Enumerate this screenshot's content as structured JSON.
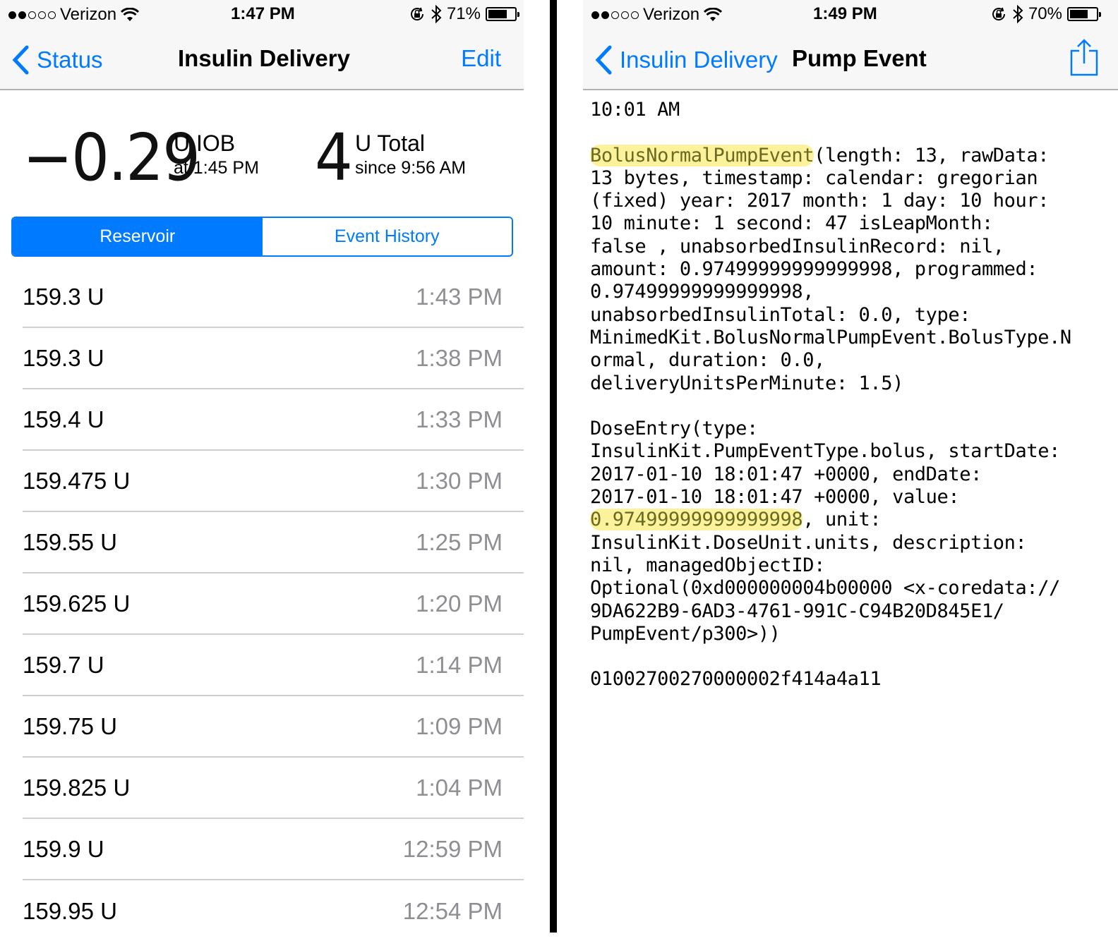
{
  "left": {
    "status_bar": {
      "carrier": "Verizon",
      "signal_bars_filled": 2,
      "signal_bars_total": 5,
      "time": "1:47 PM",
      "battery": "71%",
      "battery_fraction": 0.71
    },
    "nav": {
      "back_label": "Status",
      "title": "Insulin Delivery",
      "edit_label": "Edit"
    },
    "summary": {
      "iob_value": "−0.29",
      "iob_unit": "U IOB",
      "iob_time": "at 1:45 PM",
      "total_value": "4",
      "total_unit": "U Total",
      "total_since": "since 9:56 AM"
    },
    "segments": {
      "items": [
        "Reservoir",
        "Event History"
      ],
      "selected": "Reservoir"
    },
    "reservoir_rows": [
      {
        "value": "159.3 U",
        "time": "1:43 PM"
      },
      {
        "value": "159.3 U",
        "time": "1:38 PM"
      },
      {
        "value": "159.4 U",
        "time": "1:33 PM"
      },
      {
        "value": "159.475 U",
        "time": "1:30 PM"
      },
      {
        "value": "159.55 U",
        "time": "1:25 PM"
      },
      {
        "value": "159.625 U",
        "time": "1:20 PM"
      },
      {
        "value": "159.7 U",
        "time": "1:14 PM"
      },
      {
        "value": "159.75 U",
        "time": "1:09 PM"
      },
      {
        "value": "159.825 U",
        "time": "1:04 PM"
      },
      {
        "value": "159.9 U",
        "time": "12:59 PM"
      },
      {
        "value": "159.95 U",
        "time": "12:54 PM"
      }
    ]
  },
  "right": {
    "status_bar": {
      "carrier": "Verizon",
      "signal_bars_filled": 2,
      "signal_bars_total": 5,
      "time": "1:49 PM",
      "battery": "70%",
      "battery_fraction": 0.7
    },
    "nav": {
      "back_label": "Insulin Delivery",
      "title": "Pump Event",
      "share_icon": "share-icon"
    },
    "event": {
      "time": "10:01 AM",
      "pump_event_name": "BolusNormalPumpEvent",
      "pump_event_body": "(length: 13, rawData:\n13 bytes, timestamp: calendar: gregorian\n(fixed) year: 2017 month: 1 day: 10 hour:\n10 minute: 1 second: 47 isLeapMonth:\nfalse , unabsorbedInsulinRecord: nil,\namount: 0.97499999999999998, programmed:\n0.97499999999999998,\nunabsorbedInsulinTotal: 0.0, type:\nMinimedKit.BolusNormalPumpEvent.BolusType.N\normal, duration: 0.0,\ndeliveryUnitsPerMinute: 1.5)",
      "dose_entry_prefix": "DoseEntry(type:\nInsulinKit.PumpEventType.bolus, startDate:\n2017-01-10 18:01:47 +0000, endDate:\n2017-01-10 18:01:47 +0000, value:\n",
      "dose_value": "0.97499999999999998",
      "dose_entry_suffix": ", unit:\nInsulinKit.DoseUnit.units, description:\nnil, managedObjectID:\nOptional(0xd000000004b00000 <x-coredata://\n9DA622B9-6AD3-4761-991C-C94B20D845E1/\nPumpEvent/p300>))",
      "raw_hex": "01002700270000002f414a4a11"
    }
  },
  "colors": {
    "accent": "#007aff",
    "highlight": "#fcf29b",
    "secondary_text": "#8e8e93",
    "bar_background": "#f7f7f7"
  }
}
